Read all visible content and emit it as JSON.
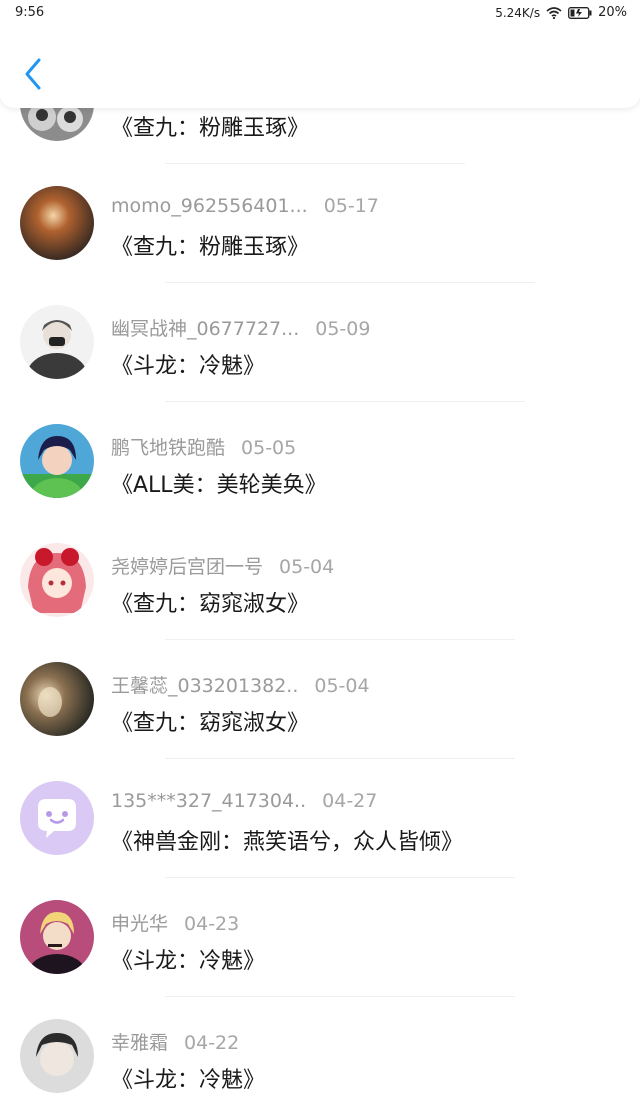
{
  "status": {
    "time": "9:56",
    "net_speed": "5.24K/s",
    "battery": "20%"
  },
  "header": {
    "back_icon": "chevron-left-icon",
    "accent": "#2196f3"
  },
  "items": [
    {
      "user": "",
      "date": "",
      "title": "《查九：粉雕玉琢》"
    },
    {
      "user": "momo_962556401...",
      "date": "05-17",
      "title": "《查九：粉雕玉琢》"
    },
    {
      "user": "幽冥战神_0677727...",
      "date": "05-09",
      "title": "《斗龙：冷魅》"
    },
    {
      "user": "鹏飞地铁跑酷",
      "date": "05-05",
      "title": "《ALL美：美轮美奂》"
    },
    {
      "user": "尧婷婷后宫团一号",
      "date": "05-04",
      "title": "《查九：窈窕淑女》"
    },
    {
      "user": "王馨蕊_033201382..",
      "date": "05-04",
      "title": "《查九：窈窕淑女》"
    },
    {
      "user": "135***327_417304..",
      "date": "04-27",
      "title": "《神兽金刚：燕笑语兮，众人皆倾》"
    },
    {
      "user": "申光华",
      "date": "04-23",
      "title": "《斗龙：冷魅》"
    },
    {
      "user": "幸雅霜",
      "date": "04-22",
      "title": "《斗龙：冷魅》"
    }
  ]
}
